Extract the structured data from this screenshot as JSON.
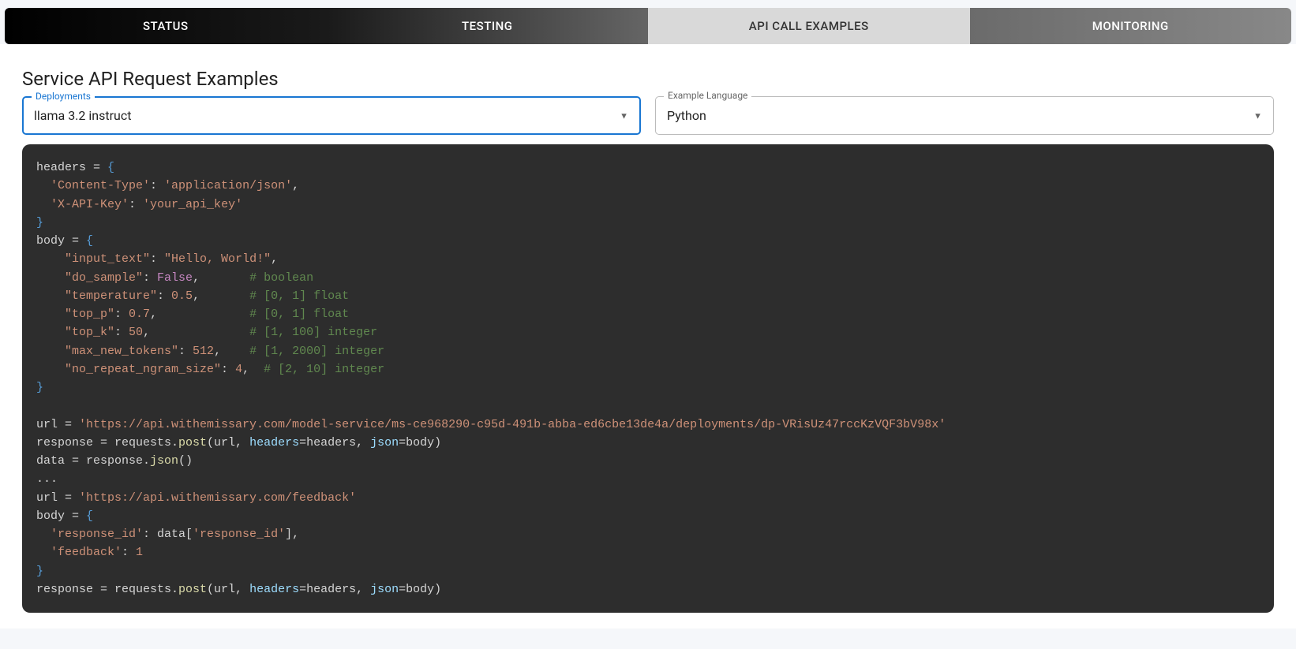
{
  "tabs": {
    "status": "STATUS",
    "testing": "TESTING",
    "api_examples": "API CALL EXAMPLES",
    "monitoring": "MONITORING"
  },
  "title": "Service API Request Examples",
  "deployments": {
    "label": "Deployments",
    "value": "llama 3.2 instruct"
  },
  "language": {
    "label": "Example Language",
    "value": "Python"
  },
  "code": {
    "line1a": "headers = ",
    "line1b": "{",
    "line2a": "  'Content-Type'",
    "line2b": ": ",
    "line2c": "'application/json'",
    "line2d": ",",
    "line3a": "  'X-API-Key'",
    "line3b": ": ",
    "line3c": "'your_api_key'",
    "line4": "}",
    "line5a": "body = ",
    "line5b": "{",
    "line6a": "    \"input_text\"",
    "line6b": ": ",
    "line6c": "\"Hello, World!\"",
    "line6d": ",",
    "line7a": "    \"do_sample\"",
    "line7b": ": ",
    "line7c": "False",
    "line7d": ",       ",
    "line7e": "# boolean",
    "line8a": "    \"temperature\"",
    "line8b": ": ",
    "line8c": "0.5",
    "line8d": ",       ",
    "line8e": "# [0, 1] float",
    "line9a": "    \"top_p\"",
    "line9b": ": ",
    "line9c": "0.7",
    "line9d": ",             ",
    "line9e": "# [0, 1] float",
    "line10a": "    \"top_k\"",
    "line10b": ": ",
    "line10c": "50",
    "line10d": ",              ",
    "line10e": "# [1, 100] integer",
    "line11a": "    \"max_new_tokens\"",
    "line11b": ": ",
    "line11c": "512",
    "line11d": ",    ",
    "line11e": "# [1, 2000] integer",
    "line12a": "    \"no_repeat_ngram_size\"",
    "line12b": ": ",
    "line12c": "4",
    "line12d": ",  ",
    "line12e": "# [2, 10] integer",
    "line13": "}",
    "line14": "",
    "line15a": "url = ",
    "line15b": "'https://api.withemissary.com/model-service/ms-ce968290-c95d-491b-abba-ed6cbe13de4a/deployments/dp-VRisUz47rccKzVQF3bV98x'",
    "line16a": "response = requests.",
    "line16b": "post",
    "line16c": "(url, ",
    "line16d": "headers",
    "line16e": "=headers, ",
    "line16f": "json",
    "line16g": "=body)",
    "line17a": "data = response.",
    "line17b": "json",
    "line17c": "()",
    "line18": "...",
    "line19a": "url = ",
    "line19b": "'https://api.withemissary.com/feedback'",
    "line20a": "body = ",
    "line20b": "{",
    "line21a": "  'response_id'",
    "line21b": ": data[",
    "line21c": "'response_id'",
    "line21d": "],",
    "line22a": "  'feedback'",
    "line22b": ": ",
    "line22c": "1",
    "line23": "}",
    "line24a": "response = requests.",
    "line24b": "post",
    "line24c": "(url, ",
    "line24d": "headers",
    "line24e": "=headers, ",
    "line24f": "json",
    "line24g": "=body)"
  }
}
